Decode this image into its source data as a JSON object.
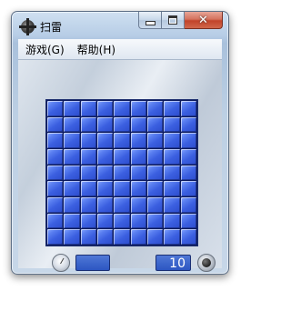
{
  "window": {
    "title": "扫雷"
  },
  "menu": {
    "items": [
      "游戏(G)",
      "帮助(H)"
    ]
  },
  "board": {
    "rows": 9,
    "cols": 9,
    "state": "all-covered"
  },
  "status": {
    "timer": "",
    "mines_remaining": "10"
  },
  "icons": {
    "app": "mine-icon",
    "minimize": "minimize-icon",
    "maximize": "maximize-icon",
    "close": "close-icon",
    "timer": "clock-icon",
    "mines": "mine-icon"
  },
  "colors": {
    "tile": "#3b5fe0",
    "close_button": "#c2432a",
    "counter": "#2c56c2"
  }
}
